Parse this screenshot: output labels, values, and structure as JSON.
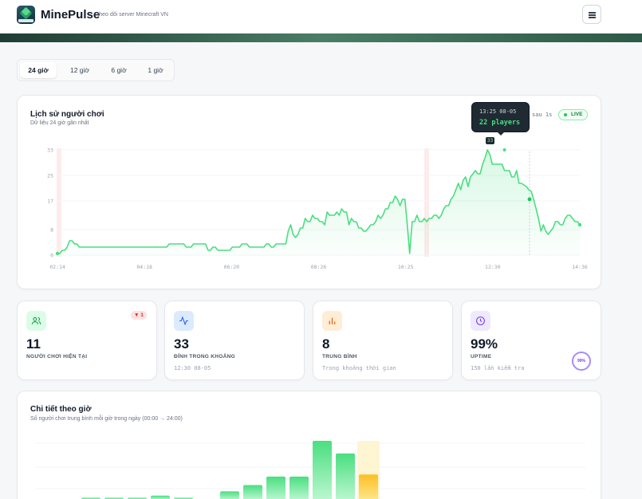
{
  "header": {
    "brand": "MinePulse",
    "subtitle": "· theo dõi server Minecraft VN",
    "logo_icon": "minecraft-gem-icon",
    "menu_icon": "hamburger-menu-icon"
  },
  "range_tabs": [
    {
      "label": "24 giờ",
      "active": true
    },
    {
      "label": "12 giờ",
      "active": false
    },
    {
      "label": "6 giờ",
      "active": false
    },
    {
      "label": "1 giờ",
      "active": false
    }
  ],
  "history": {
    "title": "Lịch sử người chơi",
    "subtitle": "Dữ liệu 24 giờ gần nhất",
    "refresh_text": "sau 1s",
    "live_label": "LIVE",
    "tooltip_time": "13:25 08-05",
    "tooltip_value": "22 players",
    "point_label": "33"
  },
  "chart_data": {
    "type": "area",
    "y_ticks": [
      "33",
      "25",
      "17",
      "8",
      "0"
    ],
    "x_ticks": [
      "02:14",
      "04:18",
      "06:20",
      "08:26",
      "10:25",
      "12:30",
      "14:36"
    ],
    "ylim": [
      0,
      33
    ],
    "color": "#4ade80",
    "series": [
      {
        "values": [
          0.5,
          0.5,
          1.5,
          1.5,
          2.5,
          4.5,
          4.5,
          3.5,
          3.5,
          2.5,
          2.5,
          2.5,
          2.5,
          2.5,
          2.5,
          2.5,
          2.5,
          2.5,
          2.5,
          2.5,
          2.5,
          2.5,
          2.5,
          2.5,
          2.5,
          2.5,
          2.5,
          2.5,
          2.5,
          2.5,
          2.5,
          2.5,
          2.5,
          2.5,
          2.5,
          2.5,
          2.5,
          2.5,
          2.5,
          2.5,
          2.5,
          2.5,
          2.5,
          2.5,
          2.5,
          2.5,
          3.5,
          3.5,
          3.5,
          3.5,
          3.5,
          3.5,
          3.5,
          2.5,
          2.5,
          2.5,
          3.5,
          3.5,
          3.5,
          3.5,
          3.5,
          3.5,
          1.5,
          1.5,
          2.5,
          2.5,
          1.5,
          1.5,
          1.5,
          1.5,
          1.5,
          1.5,
          2.5,
          2.5,
          2.5,
          2.5,
          3.5,
          3.5,
          3.5,
          2.5,
          2.5,
          2.5,
          2.5,
          2.5,
          2.5,
          2.5,
          3.5,
          3.5,
          2.5,
          2.5,
          3.5,
          3.5,
          3.5,
          3.5,
          3.5,
          7.5,
          9.5,
          6.5,
          5.5,
          6.5,
          8.5,
          8.5,
          11.5,
          10.5,
          10.5,
          12.5,
          11.5,
          11.5,
          10.5,
          10.5,
          9.5,
          13.5,
          12.5,
          12.5,
          12.5,
          13.5,
          12.5,
          14.5,
          13.5,
          13.5,
          9.5,
          11.5,
          10.5,
          10.5,
          8.5,
          8.5,
          7.5,
          7.5,
          8.5,
          9.5,
          9.5,
          10.5,
          12.5,
          11.5,
          12.5,
          14.5,
          14.5,
          16.5,
          16.5,
          18.5,
          17.5,
          15.5,
          17.5,
          17.5,
          9.5,
          0.5,
          10.5,
          10.5,
          12.5,
          10.5,
          10.5,
          11.5,
          10.5,
          11.5,
          11.5,
          12.5,
          12.5,
          11.5,
          12.5,
          14.5,
          15.5,
          15.5,
          17.5,
          18.5,
          20.5,
          22.5,
          20.5,
          23.5,
          24.5,
          21.5,
          24.5,
          25.5,
          26.5,
          25.5,
          25.5,
          28.5,
          30.5,
          33.0,
          31.5,
          28.5,
          28.5,
          28.5,
          28.5,
          28.5,
          26.5,
          26.5,
          26.5,
          24.5,
          24.5,
          26.5,
          22.5,
          22.5,
          22.0,
          21.5,
          20.5,
          20.0,
          17.5,
          14.5,
          11.5,
          7.5,
          9.5,
          7.5,
          6.5,
          7.5,
          8.5,
          10.5,
          10.5,
          9.5,
          9.5,
          11.5,
          12.5,
          12.5,
          11.5,
          10.5,
          10.5,
          9.5
        ]
      }
    ],
    "peak_index": 184,
    "peak_value": 33
  },
  "stats": [
    {
      "value": "11",
      "label": "NGƯỜI CHƠI HIỆN TẠI",
      "note": "",
      "icon": "users-icon",
      "delta": "▼ 1",
      "icon_color": "#16a34a",
      "icon_bg": "#dcfce7"
    },
    {
      "value": "33",
      "label": "ĐỈNH TRONG KHOẢNG",
      "note": "12:30 08-05",
      "icon": "activity-icon",
      "icon_color": "#2563eb",
      "icon_bg": "#dbeafe"
    },
    {
      "value": "8",
      "label": "TRUNG BÌNH",
      "note": "Trong khoảng thời gian",
      "icon": "bar-chart-icon",
      "icon_color": "#ea580c",
      "icon_bg": "#ffedd5"
    },
    {
      "value": "99%",
      "label": "UPTIME",
      "note": "150 lần kiểm tra",
      "icon": "clock-icon",
      "ring": "99%",
      "icon_color": "#7c3aed",
      "icon_bg": "#ede9fe"
    }
  ],
  "hourly": {
    "title": "Chi tiết theo giờ",
    "subtitle": "Số người chơi trung bình mỗi giờ trong ngày (00:00 → 24:00)",
    "chart_data": {
      "type": "bar",
      "values": [
        1,
        1,
        1,
        2,
        1,
        0,
        4,
        7,
        11,
        11,
        28,
        22,
        12,
        0,
        0,
        0,
        0,
        0,
        0,
        0,
        0,
        0,
        0,
        0
      ],
      "highlight_index": 12
    }
  }
}
